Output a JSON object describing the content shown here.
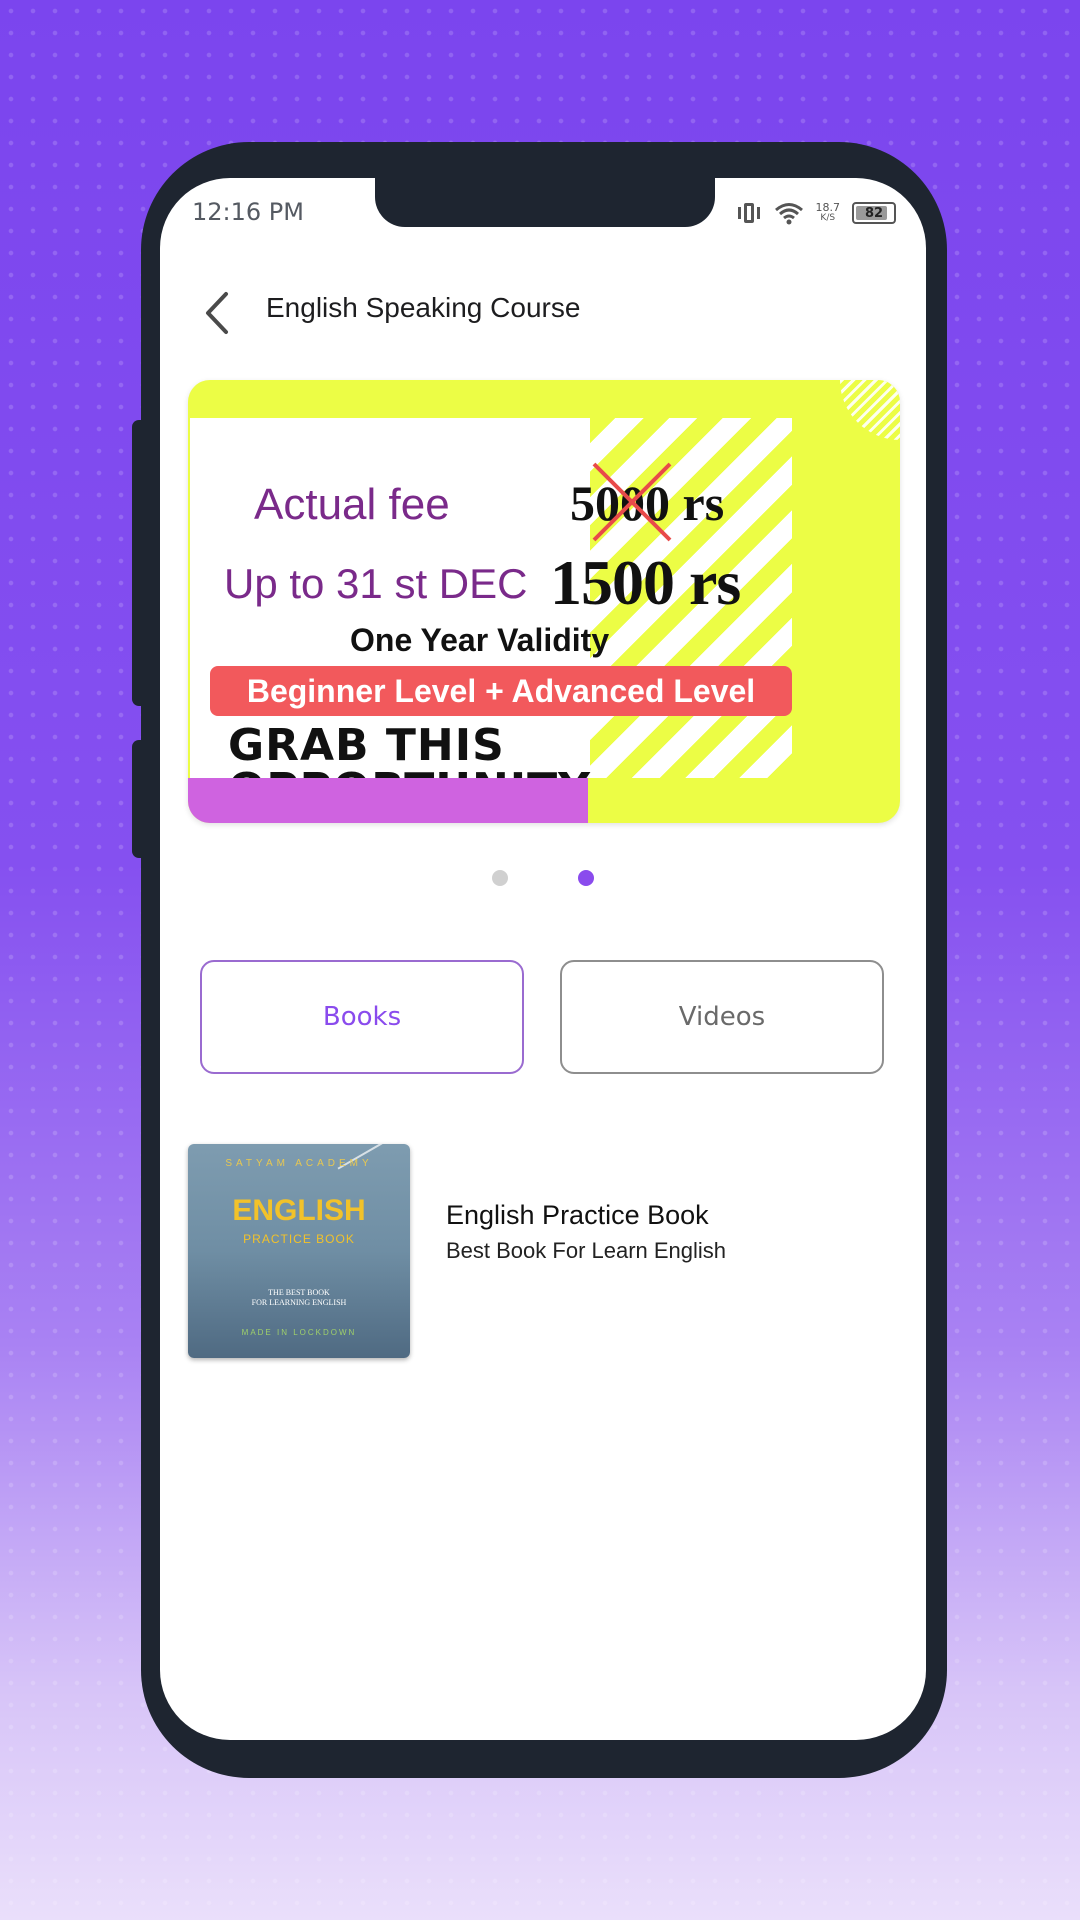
{
  "status_bar": {
    "time": "12:16 PM",
    "net_speed_value": "18.7",
    "net_speed_unit": "K/S",
    "battery": "82"
  },
  "header": {
    "back_icon": "chevron-left-icon",
    "title": "English Speaking Course"
  },
  "banner": {
    "actual_fee_label": "Actual fee",
    "old_price": "5000 rs",
    "offer_label": "Up to 31 st DEC",
    "new_price": "1500 rs",
    "validity": "One Year Validity",
    "level": "Beginner Level + Advanced Level",
    "cta_line1": "GRAB THIS",
    "cta_line2": "OPPORTUNITY",
    "colors": {
      "yellow": "#ecfd45",
      "red": "#f2595c",
      "purple": "#cf63e0",
      "text_purple": "#7a2a8a"
    }
  },
  "pager": {
    "count": 2,
    "active_index": 1,
    "active_color": "#8a4bed"
  },
  "tabs": [
    {
      "label": "Books",
      "selected": true
    },
    {
      "label": "Videos",
      "selected": false
    }
  ],
  "books": [
    {
      "cover": {
        "publisher": "SATYAM ACADEMY",
        "title": "ENGLISH",
        "subtitle": "PRACTICE BOOK",
        "tagline_1": "THE BEST BOOK",
        "tagline_2": "FOR LEARNING ENGLISH",
        "footer": "MADE IN LOCKDOWN"
      },
      "title": "English Practice Book",
      "description": "Best Book For Learn English"
    }
  ],
  "accent_color": "#8a4bed",
  "background_color": "#7b45ee"
}
